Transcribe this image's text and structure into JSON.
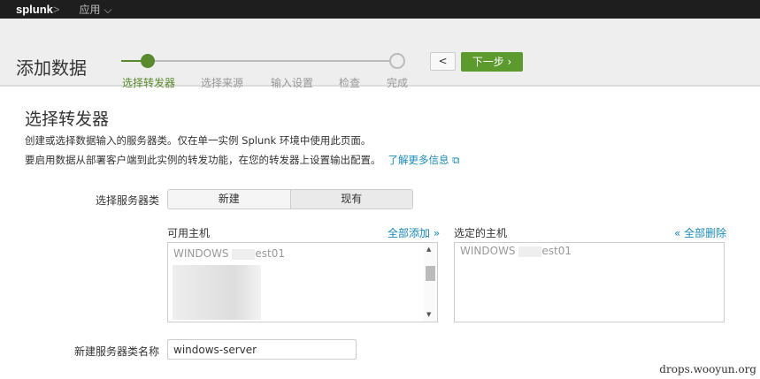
{
  "topbar": {
    "logo": "splunk",
    "logo_suffix": ">",
    "app_menu": "应用 ⌵"
  },
  "header": {
    "title": "添加数据",
    "steps": [
      "选择转发器",
      "选择来源",
      "输入设置",
      "检查",
      "完成"
    ],
    "active_step": 0,
    "back": "<",
    "next": "下一步 ›"
  },
  "main": {
    "heading": "选择转发器",
    "desc1": "创建或选择数据输入的服务器类。仅在单一实例 Splunk 环境中使用此页面。",
    "desc2": "要启用数据从部署客户端到此实例的转发功能，在您的转发器上设置输出配置。",
    "learn_more": "了解更多信息 ⧉",
    "server_class_label": "选择服务器类",
    "seg": [
      "新建",
      "现有"
    ],
    "available_title": "可用主机",
    "add_all": "全部添加 »",
    "selected_title": "选定的主机",
    "remove_all": "« 全部删除",
    "available_host_a": "WINDOWS",
    "available_host_b": "est01",
    "selected_host_a": "WINDOWS",
    "selected_host_b": "est01",
    "name_label": "新建服务器类名称",
    "name_value": "windows-server"
  },
  "watermark": "drops.wooyun.org"
}
